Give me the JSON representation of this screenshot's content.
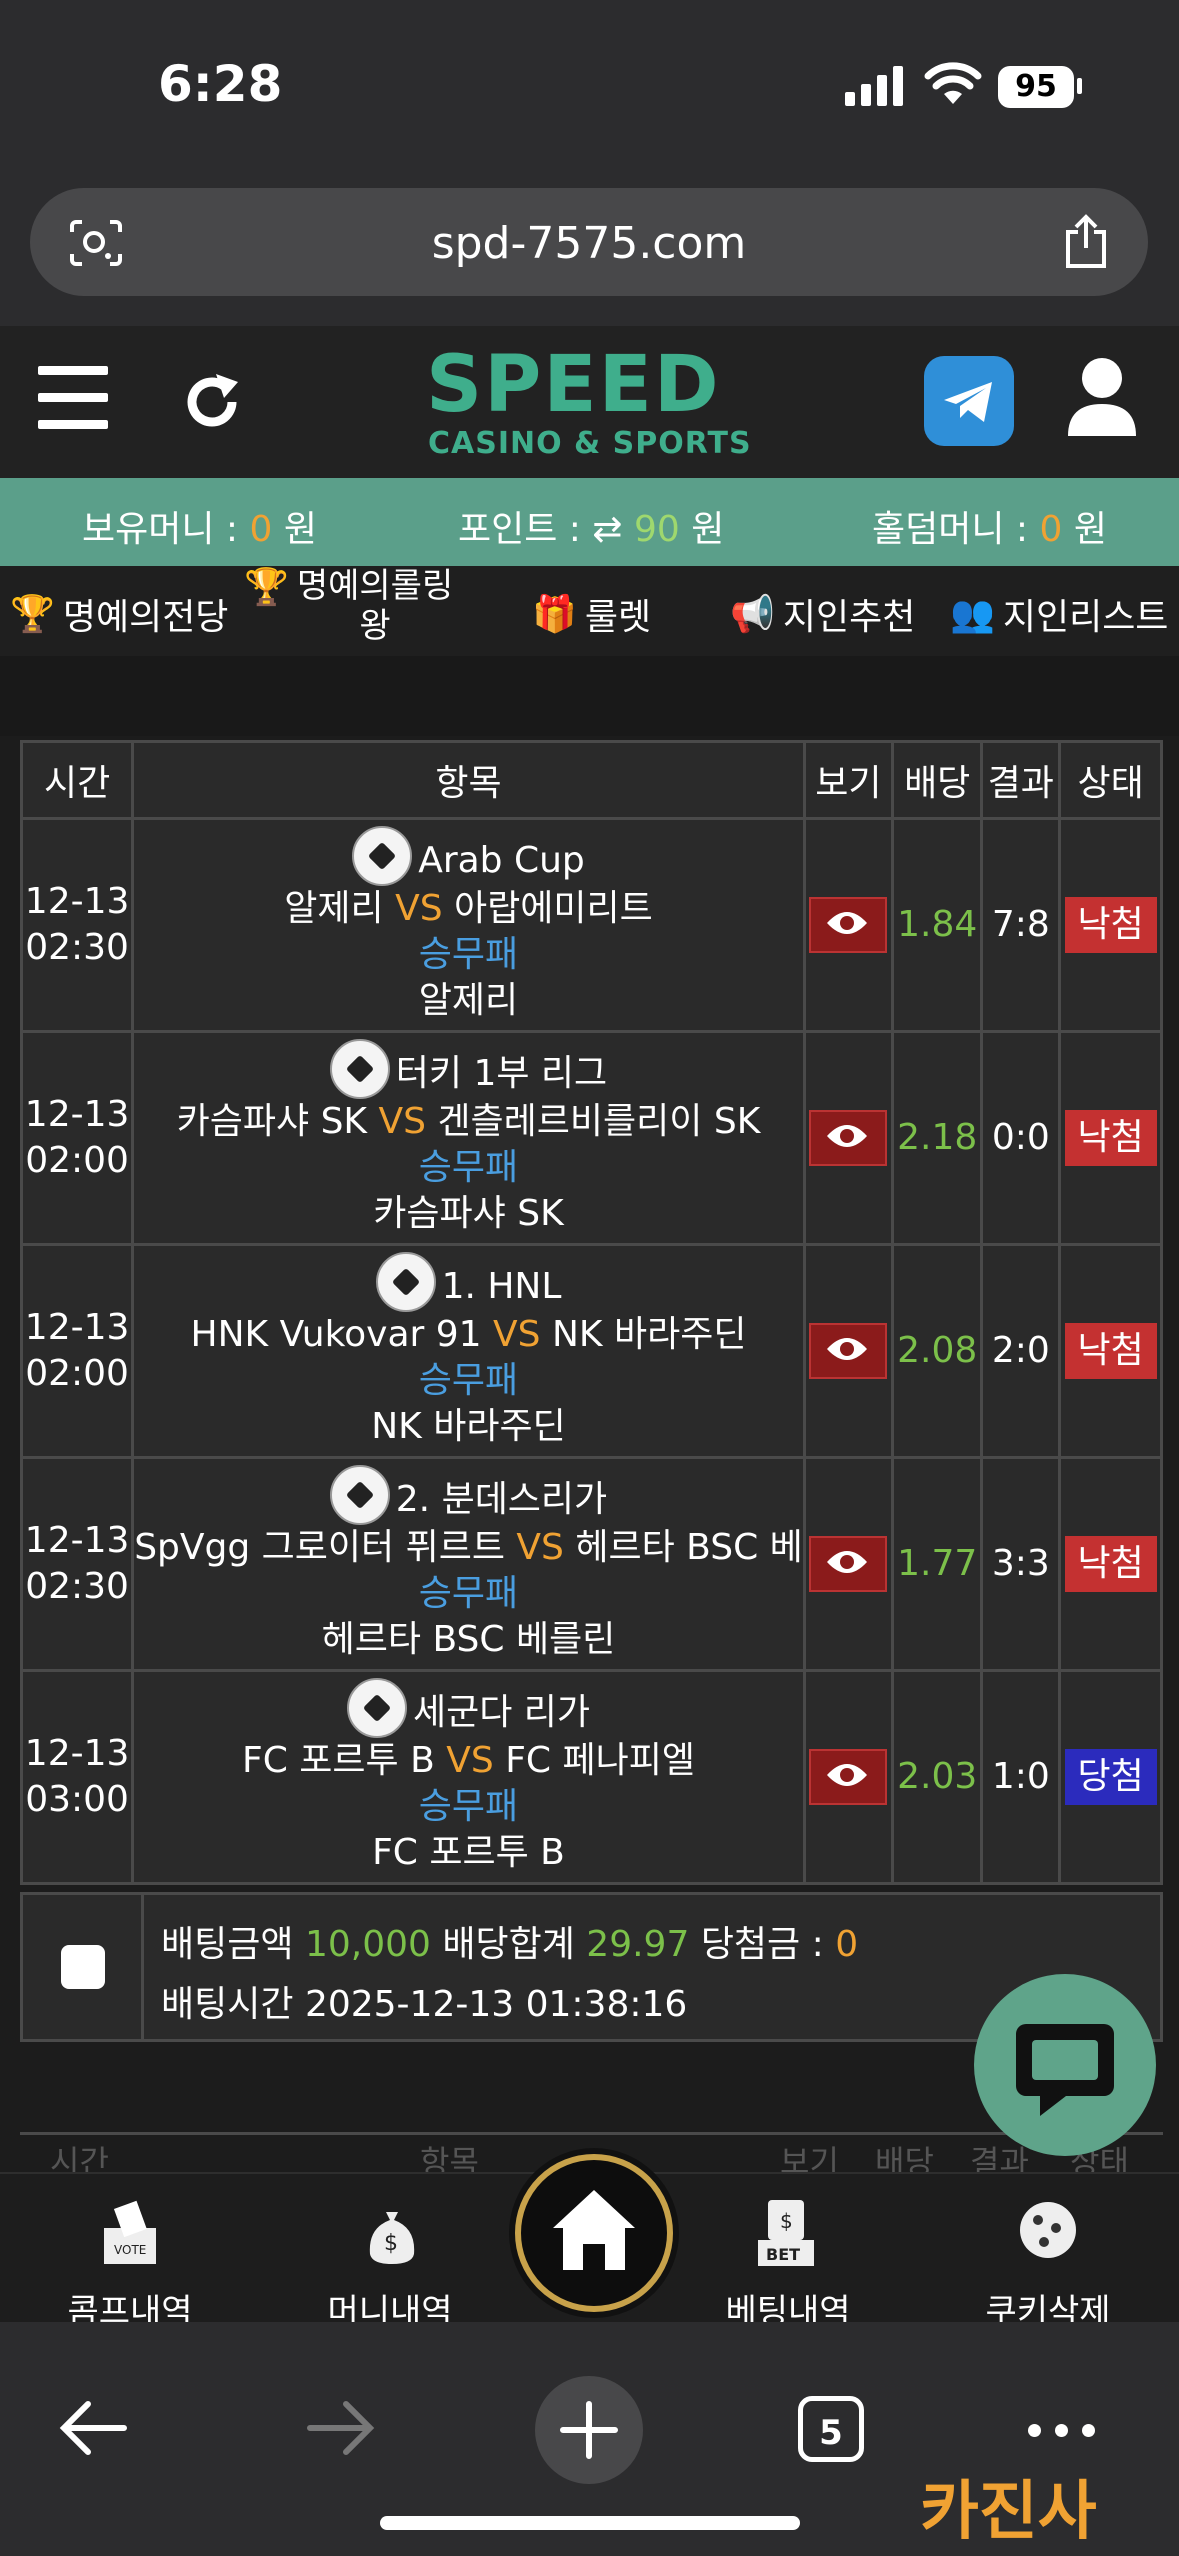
{
  "status": {
    "time": "6:28",
    "battery": "95"
  },
  "browser": {
    "url": "spd-7575.com",
    "tabs_count": "5"
  },
  "site": {
    "logo": "SPEED",
    "logo_sub": "CASINO & SPORTS",
    "money": {
      "held_label": "보유머니 :",
      "held_value": "0",
      "held_unit": "원",
      "point_label": "포인트 :",
      "point_value": "90",
      "point_unit": "원",
      "holdem_label": "홀덤머니 :",
      "holdem_value": "0",
      "holdem_unit": "원"
    },
    "menu": [
      "명예의전당",
      "명예의롤링",
      "왕",
      "룰렛",
      "지인추천",
      "지인리스트"
    ]
  },
  "table": {
    "headers": [
      "시간",
      "항목",
      "보기",
      "배당",
      "결과",
      "상태"
    ],
    "rows": [
      {
        "date": "12-13",
        "time": "02:30",
        "league": "Arab Cup",
        "home": "알제리",
        "vs": "VS",
        "away": "아랍에미리트",
        "market": "승무패",
        "pick": "알제리",
        "odds": "1.84",
        "result": "7:8",
        "status": "낙첨"
      },
      {
        "date": "12-13",
        "time": "02:00",
        "league": "터키 1부 리그",
        "home": "카슴파샤 SK",
        "vs": "VS",
        "away": "겐츨레르비를리이 SK",
        "market": "승무패",
        "pick": "카슴파샤 SK",
        "odds": "2.18",
        "result": "0:0",
        "status": "낙첨"
      },
      {
        "date": "12-13",
        "time": "02:00",
        "league": "1. HNL",
        "home": "HNK Vukovar 91",
        "vs": "VS",
        "away": "NK 바라주딘",
        "market": "승무패",
        "pick": "NK 바라주딘",
        "odds": "2.08",
        "result": "2:0",
        "status": "낙첨"
      },
      {
        "date": "12-13",
        "time": "02:30",
        "league": "2. 분데스리가",
        "home": "SpVgg 그로이터 퓌르트",
        "vs": "VS",
        "away": "헤르타 BSC 베",
        "market": "승무패",
        "pick": "헤르타 BSC 베를린",
        "odds": "1.77",
        "result": "3:3",
        "status": "낙첨"
      },
      {
        "date": "12-13",
        "time": "03:00",
        "league": "세군다 리가",
        "home": "FC 포르투 B",
        "vs": "VS",
        "away": "FC 페나피엘",
        "market": "승무패",
        "pick": "FC 포르투 B",
        "odds": "2.03",
        "result": "1:0",
        "status": "당첨"
      }
    ],
    "summary": {
      "bet_amount_label": "배팅금액",
      "bet_amount": "10,000",
      "odds_total_label": "배당합계",
      "odds_total": "29.97",
      "win_label": "당첨금 :",
      "win_amount": "0",
      "bet_time_label": "배팅시간",
      "bet_time": "2025-12-13 01:38:16"
    },
    "next_headers": [
      "시간",
      "항목",
      "보기",
      "배당",
      "결과",
      "상태"
    ]
  },
  "bottom_nav": [
    "콤프내역",
    "머니내역",
    "베팅내역",
    "쿠키삭제"
  ],
  "watermark": "카진사"
}
